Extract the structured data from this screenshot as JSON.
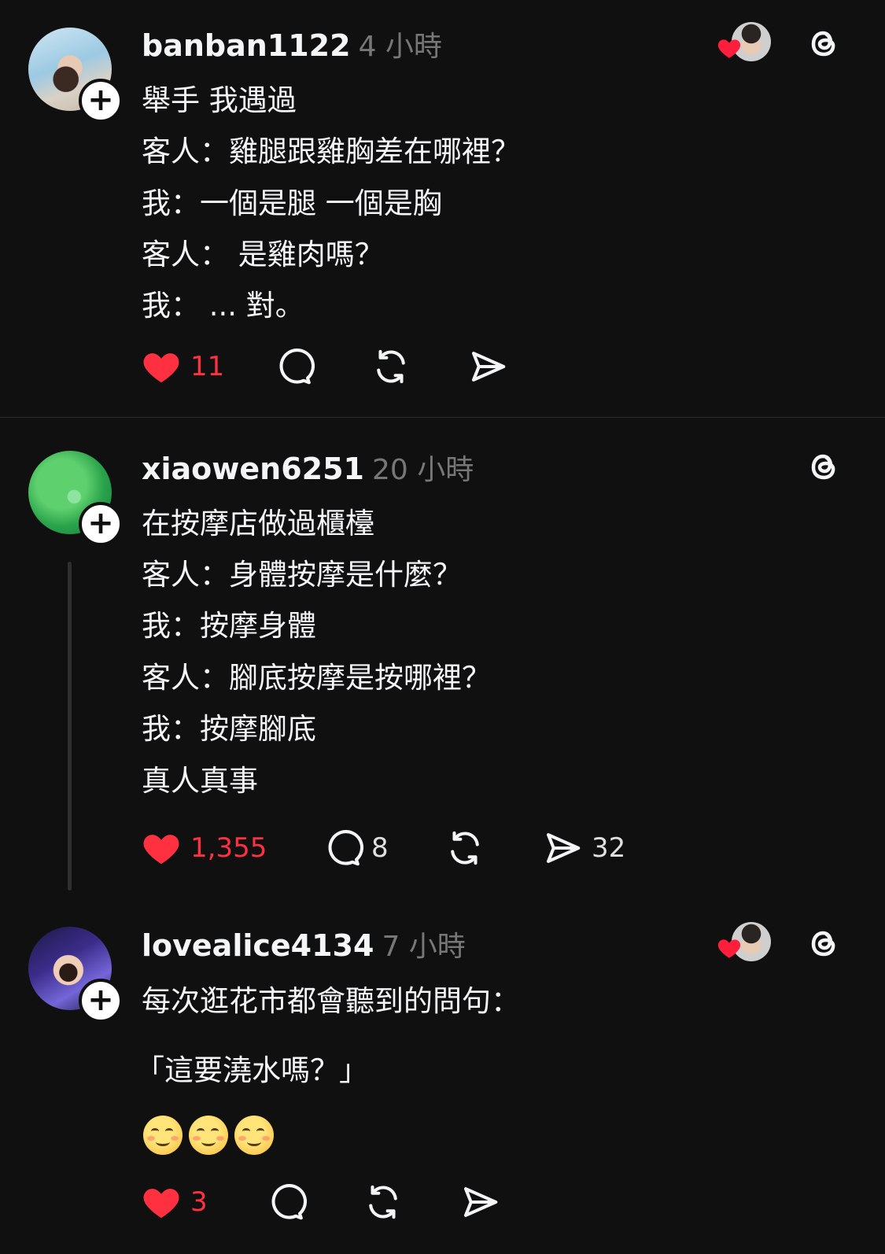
{
  "posts": [
    {
      "username": "banban1122",
      "time": "4 小時",
      "lines": [
        "舉手 我遇過",
        "客人：雞腿跟雞胸差在哪裡？",
        "我：一個是腿 一個是胸",
        "客人：  是雞肉嗎？",
        "我： ... 對。"
      ],
      "likes": "11",
      "comments": "",
      "reposts": "",
      "shares": "",
      "liked_by_followed": true
    },
    {
      "username": "xiaowen6251",
      "time": "20 小時",
      "lines": [
        "在按摩店做過櫃檯",
        "客人：身體按摩是什麼？",
        "我：按摩身體",
        "客人：腳底按摩是按哪裡？",
        "我：按摩腳底",
        "真人真事"
      ],
      "likes": "1,355",
      "comments": "8",
      "reposts": "",
      "shares": "32",
      "liked_by_followed": false
    },
    {
      "username": "lovealice4134",
      "time": "7 小時",
      "lines": [
        "每次逛花市都會聽到的問句：",
        "「這要澆水嗎？」"
      ],
      "emojis": "☺️☺️☺️",
      "likes": "3",
      "comments": "",
      "reposts": "",
      "shares": "",
      "liked_by_followed": true
    }
  ],
  "colors": {
    "background": "#101010",
    "text": "#f3f5f7",
    "muted": "#777777",
    "like": "#ff3040"
  },
  "icons": {
    "heart": "heart-icon",
    "comment": "comment-icon",
    "repost": "repost-icon",
    "share": "share-icon",
    "threads": "threads-logo-icon",
    "follow": "plus-icon"
  }
}
